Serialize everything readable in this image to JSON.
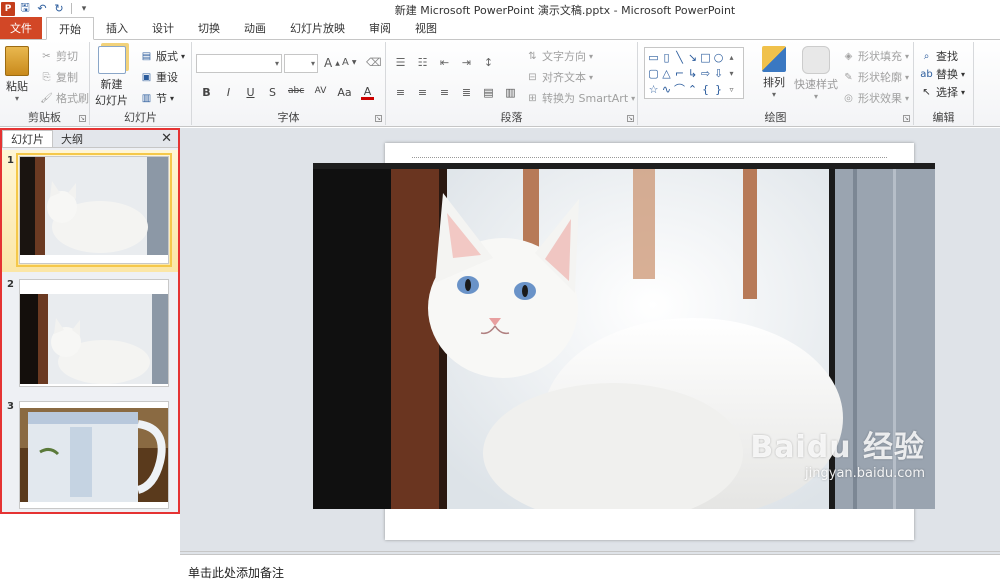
{
  "window": {
    "title": "新建 Microsoft PowerPoint 演示文稿.pptx - Microsoft PowerPoint"
  },
  "qat": {
    "app_glyph": "P",
    "save": "🖫",
    "undo": "↶",
    "redo": "↻",
    "customize": "▾"
  },
  "tabs": [
    {
      "label": "文件"
    },
    {
      "label": "开始"
    },
    {
      "label": "插入"
    },
    {
      "label": "设计"
    },
    {
      "label": "切换"
    },
    {
      "label": "动画"
    },
    {
      "label": "幻灯片放映"
    },
    {
      "label": "审阅"
    },
    {
      "label": "视图"
    }
  ],
  "ribbon": {
    "clipboard": {
      "label": "剪贴板",
      "paste": "粘贴",
      "cut": "剪切",
      "copy": "复制",
      "format_painter": "格式刷"
    },
    "slides": {
      "label": "幻灯片",
      "new_slide_1": "新建",
      "new_slide_2": "幻灯片",
      "layout": "版式",
      "reset": "重设",
      "section": "节"
    },
    "font": {
      "label": "字体",
      "bold": "B",
      "italic": "I",
      "underline": "U",
      "shadow": "S",
      "strike": "abc",
      "spacing": "AV",
      "case": "Aa",
      "color": "A",
      "grow": "A",
      "shrink": "A"
    },
    "paragraph": {
      "label": "段落",
      "text_direction": "文字方向",
      "align_text": "对齐文本",
      "smartart": "转换为 SmartArt"
    },
    "drawing": {
      "label": "绘图",
      "arrange": "排列",
      "quick_styles": "快速样式",
      "shape_fill": "形状填充",
      "shape_outline": "形状轮廓",
      "shape_effects": "形状效果"
    },
    "editing": {
      "label": "编辑",
      "find": "查找",
      "replace": "替换",
      "select": "选择"
    }
  },
  "panel": {
    "tab_slides": "幻灯片",
    "tab_outline": "大纲",
    "close": "✕",
    "slides": [
      {
        "num": "1"
      },
      {
        "num": "2"
      },
      {
        "num": "3"
      }
    ]
  },
  "notes": {
    "placeholder": "单击此处添加备注"
  },
  "watermark": {
    "brand": "Baidu 经验",
    "url": "jingyan.baidu.com"
  },
  "colors": {
    "file_tab": "#d24726",
    "selection_border": "#e53333",
    "thumb_selected": "#f5c84a"
  }
}
